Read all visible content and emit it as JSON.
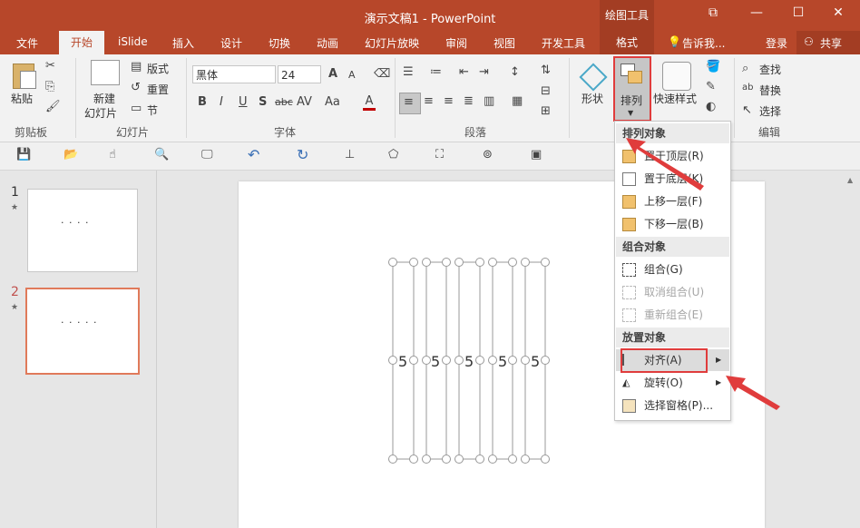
{
  "window": {
    "title": "演示文稿1 - PowerPoint",
    "context_tab_group": "绘图工具",
    "controls": [
      "restore-icon",
      "minimize-icon",
      "maximize-icon",
      "close-icon"
    ]
  },
  "tabs": [
    "文件",
    "开始",
    "iSlide",
    "插入",
    "设计",
    "切换",
    "动画",
    "幻灯片放映",
    "审阅",
    "视图",
    "开发工具",
    "格式"
  ],
  "tell_me": "告诉我...",
  "signin": "登录",
  "share": "共享",
  "ribbon": {
    "clipboard": {
      "label": "剪贴板",
      "paste": "粘贴"
    },
    "slides": {
      "label": "幻灯片",
      "new_slide_1": "新建",
      "new_slide_2": "幻灯片",
      "layout": "版式",
      "reset": "重置",
      "section": "节"
    },
    "font": {
      "label": "字体",
      "font_name": "黑体",
      "font_size": "24",
      "bold": "B",
      "italic": "I",
      "underline": "U",
      "shadow": "S",
      "strike": "abc",
      "spacing": "AV",
      "case": "Aa",
      "color": "A",
      "grow": "A",
      "shrink": "A"
    },
    "paragraph": {
      "label": "段落"
    },
    "drawing": {
      "shape": "形状",
      "arrange": "排列",
      "quick_styles": "快速样式"
    },
    "editing": {
      "label": "编辑",
      "find": "查找",
      "replace": "替换",
      "select": "选择"
    }
  },
  "thumbnails": [
    {
      "number": "1",
      "star": "★",
      "content": "· · · ·"
    },
    {
      "number": "2",
      "star": "★",
      "content": "· · · · ·"
    }
  ],
  "slide": {
    "numbers": [
      "5",
      "5",
      "5",
      "5",
      "5"
    ]
  },
  "menu": {
    "sections": [
      {
        "header": "排列对象",
        "items": [
          {
            "label": "置于顶层(R)",
            "enabled": true
          },
          {
            "label": "置于底层(K)",
            "enabled": true
          },
          {
            "label": "上移一层(F)",
            "enabled": true
          },
          {
            "label": "下移一层(B)",
            "enabled": true
          }
        ]
      },
      {
        "header": "组合对象",
        "items": [
          {
            "label": "组合(G)",
            "enabled": true
          },
          {
            "label": "取消组合(U)",
            "enabled": false
          },
          {
            "label": "重新组合(E)",
            "enabled": false
          }
        ]
      },
      {
        "header": "放置对象",
        "items": [
          {
            "label": "对齐(A)",
            "enabled": true
          },
          {
            "label": "旋转(O)",
            "enabled": true
          },
          {
            "label": "选择窗格(P)...",
            "enabled": true
          }
        ]
      }
    ]
  },
  "colors": {
    "accent": "#b7472a",
    "highlight": "#e03c3c"
  }
}
